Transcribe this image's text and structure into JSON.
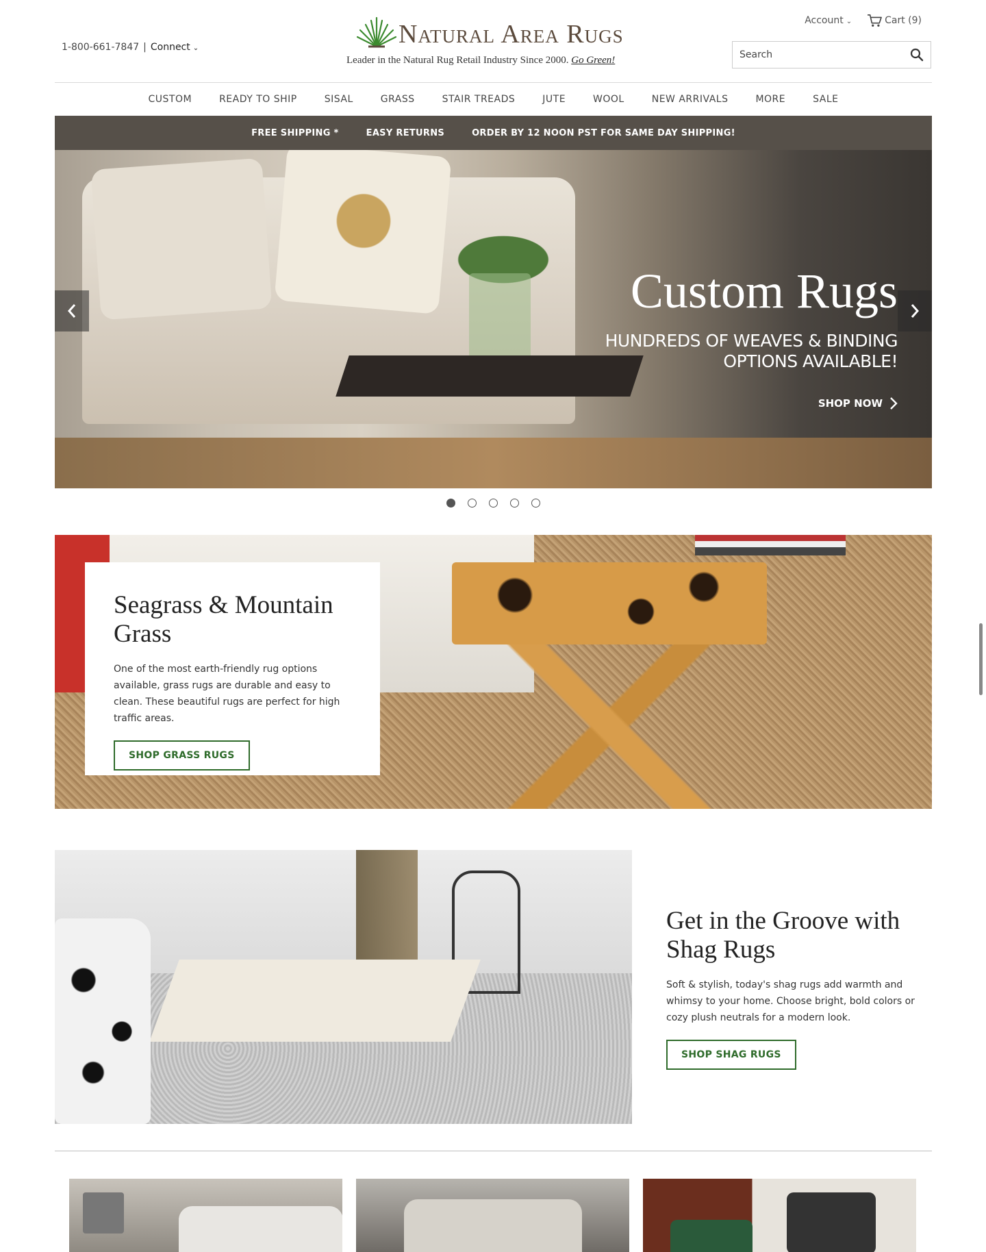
{
  "header": {
    "phone": "1-800-661-7847",
    "separator": "|",
    "connect_label": "Connect",
    "brand_name": "Natural Area Rugs",
    "tagline": "Leader in the Natural Rug Retail Industry Since 2000.",
    "tagline_link": "Go Green!",
    "account_label": "Account",
    "cart_label": "Cart (9)",
    "search_placeholder": "Search"
  },
  "nav": {
    "items": [
      "CUSTOM",
      "READY TO SHIP",
      "SISAL",
      "GRASS",
      "STAIR TREADS",
      "JUTE",
      "WOOL",
      "NEW ARRIVALS",
      "MORE",
      "SALE"
    ]
  },
  "promo": {
    "items": [
      "FREE SHIPPING *",
      "EASY RETURNS",
      "ORDER BY 12 NOON PST FOR SAME DAY SHIPPING!"
    ]
  },
  "hero": {
    "title": "Custom Rugs",
    "subtitle": "HUNDREDS OF WEAVES & BINDING\nOPTIONS AVAILABLE!",
    "cta": "SHOP NOW",
    "slide_count": 5,
    "active_slide": 1
  },
  "feature_grass": {
    "title": "Seagrass & Mountain Grass",
    "body": "One of the most earth-friendly rug options available, grass rugs are durable and easy to clean. These beautiful rugs are perfect for high traffic areas.",
    "button": "SHOP GRASS RUGS"
  },
  "feature_shag": {
    "title": "Get in the Groove with Shag Rugs",
    "body": "Soft & stylish, today's shag rugs add warmth and whimsy to your home. Choose bright, bold colors or cozy plush neutrals for a modern look.",
    "button": "SHOP SHAG RUGS"
  },
  "colors": {
    "brand_green": "#2e6b2a",
    "promo_bar": "#565049",
    "logo_brown": "#5b4a3c"
  }
}
